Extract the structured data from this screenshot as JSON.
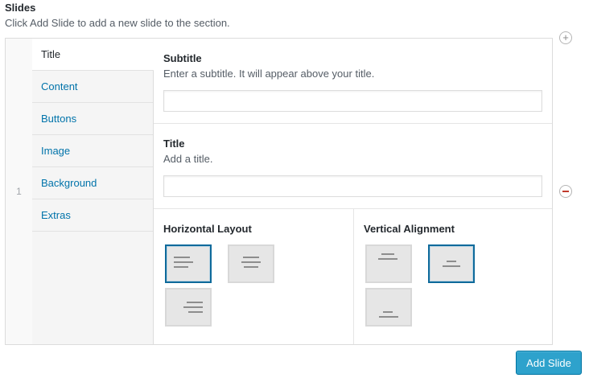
{
  "section": {
    "title": "Slides",
    "description": "Click Add Slide to add a new slide to the section."
  },
  "slide": {
    "number": "1",
    "tabs": [
      {
        "label": "Title",
        "active": true
      },
      {
        "label": "Content"
      },
      {
        "label": "Buttons"
      },
      {
        "label": "Image"
      },
      {
        "label": "Background"
      },
      {
        "label": "Extras"
      }
    ],
    "fields": {
      "subtitle": {
        "label": "Subtitle",
        "description": "Enter a subtitle. It will appear above your title.",
        "value": ""
      },
      "title": {
        "label": "Title",
        "description": "Add a title.",
        "value": ""
      }
    },
    "horizontal_layout": {
      "label": "Horizontal Layout",
      "options": [
        "align-left-icon",
        "align-center-icon",
        "align-right-icon"
      ],
      "selected": "align-left-icon"
    },
    "vertical_alignment": {
      "label": "Vertical Alignment",
      "options": [
        "align-top-icon",
        "align-middle-icon",
        "align-bottom-icon"
      ],
      "selected": "align-middle-icon"
    }
  },
  "controls": {
    "add_icon": "plus-icon",
    "remove_icon": "minus-icon",
    "add_slide_label": "Add Slide"
  },
  "colors": {
    "link": "#0073aa",
    "primary_button": "#2ea2cc",
    "selected_border": "#0e6a9b",
    "remove": "#c0392b"
  }
}
